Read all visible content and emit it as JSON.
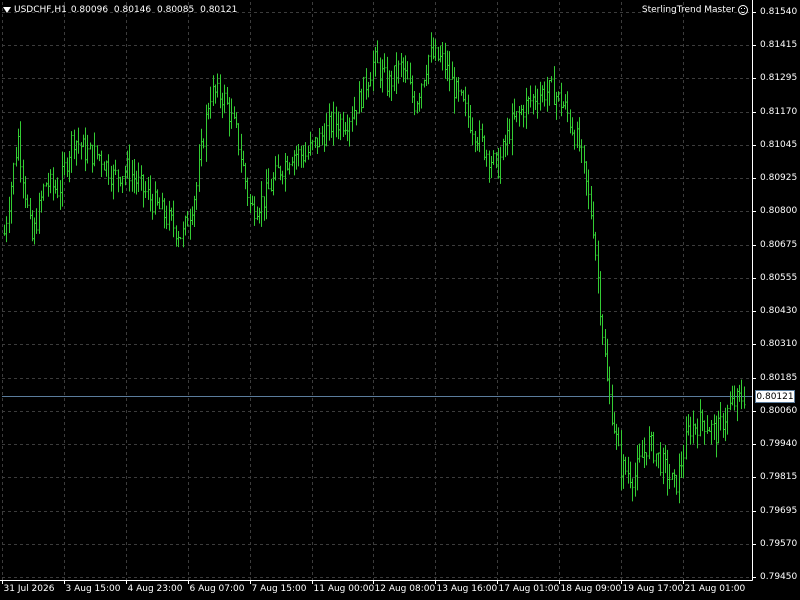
{
  "header": {
    "symbol": "USDCHF,H1",
    "open": "0.80096",
    "high": "0.80146",
    "low": "0.80085",
    "close": "0.80121",
    "expert_name": "SterlingTrend Master",
    "expert_icon": "smiley-face-icon"
  },
  "price_axis": {
    "labels": [
      "0.81540",
      "0.81415",
      "0.81295",
      "0.81170",
      "0.81045",
      "0.80925",
      "0.80800",
      "0.80675",
      "0.80555",
      "0.80430",
      "0.80310",
      "0.80185",
      "0.80060",
      "0.79940",
      "0.79815",
      "0.79695",
      "0.79570",
      "0.79450"
    ],
    "current_price": "0.80121"
  },
  "time_axis": {
    "labels": [
      "31 Jul 2026",
      "3 Aug 15:00",
      "4 Aug 23:00",
      "6 Aug 07:00",
      "7 Aug 15:00",
      "11 Aug 00:00",
      "12 Aug 08:00",
      "13 Aug 16:00",
      "17 Aug 01:00",
      "18 Aug 09:00",
      "19 Aug 17:00",
      "21 Aug 01:00"
    ]
  },
  "colors": {
    "background": "#000000",
    "grid": "#3c3c3c",
    "bars": "#33cc33",
    "text": "#ffffff",
    "price_line": "#5b7c9c"
  },
  "chart_data": {
    "type": "ohlc",
    "ylim": [
      0.7945,
      0.8154
    ],
    "grid": true,
    "title": "",
    "xlabel": "",
    "ylabel": "",
    "close_path": [
      [
        "31 Jul 2026",
        0.8072
      ],
      [
        "",
        0.8108
      ],
      [
        "",
        0.8069
      ],
      [
        "",
        0.8091
      ],
      [
        "",
        0.8088
      ],
      [
        "",
        0.8108
      ],
      [
        "3 Aug 15:00",
        0.8102
      ],
      [
        "",
        0.8101
      ],
      [
        "",
        0.8093
      ],
      [
        "",
        0.8096
      ],
      [
        "4 Aug 23:00",
        0.8089
      ],
      [
        "",
        0.8083
      ],
      [
        "",
        0.8077
      ],
      [
        "",
        0.8071
      ],
      [
        "",
        0.8088
      ],
      [
        "6 Aug 07:00",
        0.8124
      ],
      [
        "",
        0.8123
      ],
      [
        "",
        0.8108
      ],
      [
        "7 Aug 15:00",
        0.8081
      ],
      [
        "",
        0.8085
      ],
      [
        "",
        0.8095
      ],
      [
        "",
        0.8102
      ],
      [
        "",
        0.8101
      ],
      [
        "11 Aug 00:00",
        0.8107
      ],
      [
        "",
        0.8113
      ],
      [
        "",
        0.8114
      ],
      [
        "",
        0.8122
      ],
      [
        "12 Aug 08:00",
        0.8136
      ],
      [
        "",
        0.8127
      ],
      [
        "",
        0.8134
      ],
      [
        "",
        0.812
      ],
      [
        "13 Aug 16:00",
        0.8138
      ],
      [
        "",
        0.8136
      ],
      [
        "",
        0.8124
      ],
      [
        "",
        0.8114
      ],
      [
        "17 Aug 01:00",
        0.8104
      ],
      [
        "",
        0.8096
      ],
      [
        "",
        0.8112
      ],
      [
        "",
        0.8119
      ],
      [
        "18 Aug 09:00",
        0.8124
      ],
      [
        "",
        0.8125
      ],
      [
        "",
        0.8118
      ],
      [
        "",
        0.8104
      ],
      [
        "",
        0.8075
      ],
      [
        "",
        0.8017
      ],
      [
        "",
        0.7986
      ],
      [
        "19 Aug 17:00",
        0.7982
      ],
      [
        "",
        0.7995
      ],
      [
        "",
        0.7987
      ],
      [
        "",
        0.7978
      ],
      [
        "",
        0.8
      ],
      [
        "",
        0.8003
      ],
      [
        "21 Aug 01:00",
        0.7998
      ],
      [
        "",
        0.8008
      ],
      [
        "",
        0.8012
      ]
    ]
  }
}
